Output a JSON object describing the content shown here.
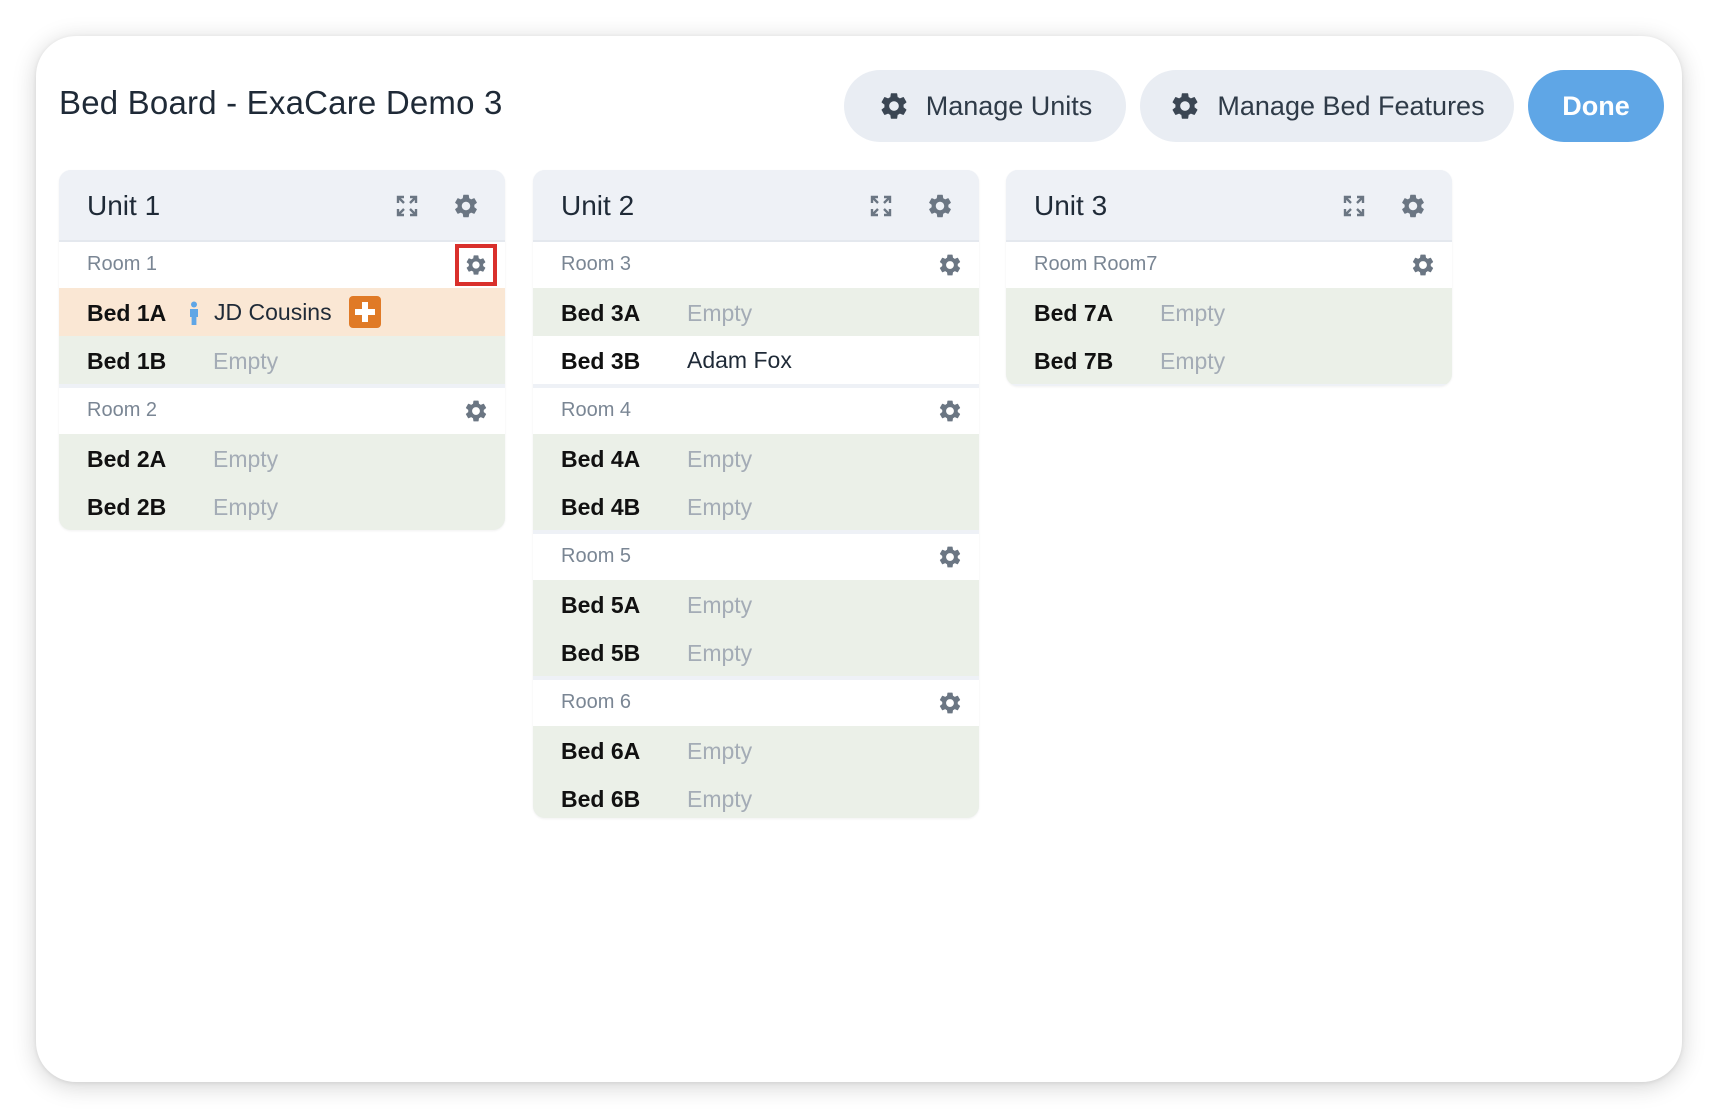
{
  "header": {
    "title": "Bed Board - ExaCare Demo 3",
    "manage_units_label": "Manage Units",
    "manage_features_label": "Manage Bed Features",
    "done_label": "Done"
  },
  "colors": {
    "primary": "#5fa6e6",
    "occupied_row": "#fae7d4",
    "empty_row": "#ebf0e8",
    "badge": "#e07a26",
    "highlight": "#d9302c"
  },
  "units": [
    {
      "name": "Unit 1",
      "rooms": [
        {
          "label": "Room 1",
          "beds": [
            {
              "label": "Bed 1A",
              "resident": "JD Cousins"
            },
            {
              "label": "Bed 1B",
              "status": "Empty"
            }
          ]
        },
        {
          "label": "Room 2",
          "beds": [
            {
              "label": "Bed 2A",
              "status": "Empty"
            },
            {
              "label": "Bed 2B",
              "status": "Empty"
            }
          ]
        }
      ]
    },
    {
      "name": "Unit 2",
      "rooms": [
        {
          "label": "Room 3",
          "beds": [
            {
              "label": "Bed 3A",
              "status": "Empty"
            },
            {
              "label": "Bed 3B",
              "resident": "Adam Fox"
            }
          ]
        },
        {
          "label": "Room 4",
          "beds": [
            {
              "label": "Bed 4A",
              "status": "Empty"
            },
            {
              "label": "Bed 4B",
              "status": "Empty"
            }
          ]
        },
        {
          "label": "Room 5",
          "beds": [
            {
              "label": "Bed 5A",
              "status": "Empty"
            },
            {
              "label": "Bed 5B",
              "status": "Empty"
            }
          ]
        },
        {
          "label": "Room 6",
          "beds": [
            {
              "label": "Bed 6A",
              "status": "Empty"
            },
            {
              "label": "Bed 6B",
              "status": "Empty"
            }
          ]
        }
      ]
    },
    {
      "name": "Unit 3",
      "rooms": [
        {
          "label": "Room Room7",
          "beds": [
            {
              "label": "Bed 7A",
              "status": "Empty"
            },
            {
              "label": "Bed 7B",
              "status": "Empty"
            }
          ]
        }
      ]
    }
  ]
}
